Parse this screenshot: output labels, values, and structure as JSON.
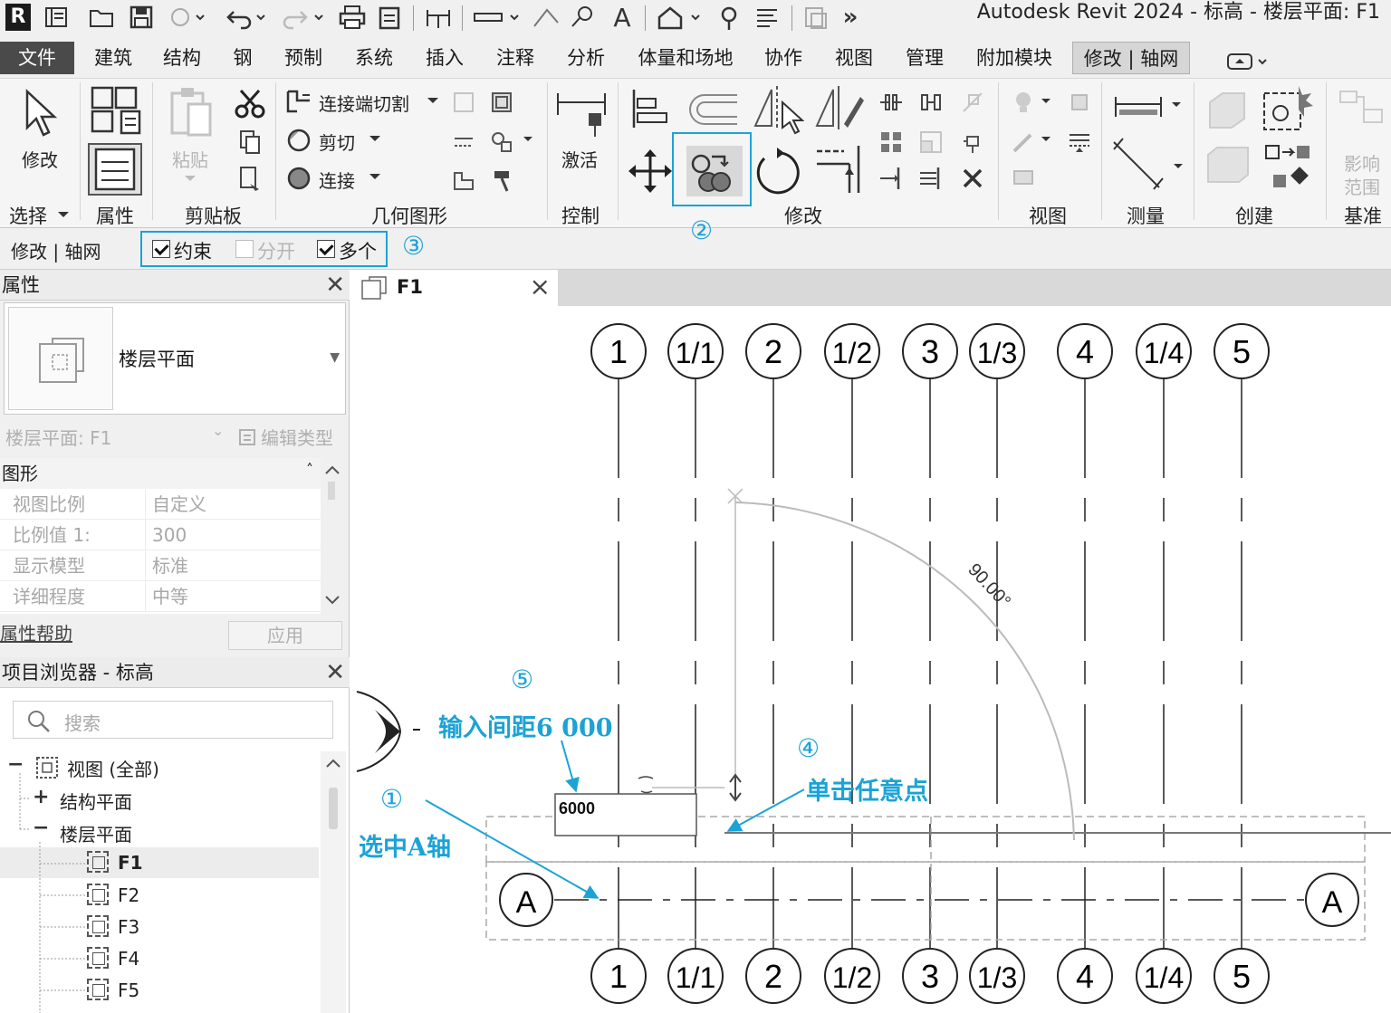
{
  "titlebar": {
    "app_logo": "R",
    "window_title": "Autodesk Revit 2024 - 标高 - 楼层平面: F1",
    "text_tool_glyph": "A",
    "overflow_glyph": "»"
  },
  "menu_tabs": [
    {
      "label": "文件"
    },
    {
      "label": "建筑"
    },
    {
      "label": "结构"
    },
    {
      "label": "钢"
    },
    {
      "label": "预制"
    },
    {
      "label": "系统"
    },
    {
      "label": "插入"
    },
    {
      "label": "注释"
    },
    {
      "label": "分析"
    },
    {
      "label": "体量和场地"
    },
    {
      "label": "协作"
    },
    {
      "label": "视图"
    },
    {
      "label": "管理"
    },
    {
      "label": "附加模块"
    },
    {
      "label": "修改 | 轴网"
    }
  ],
  "ribbon": {
    "select": {
      "modify_label": "修改",
      "panel": "选择"
    },
    "properties": {
      "panel": "属性"
    },
    "clipboard": {
      "paste_label": "粘贴",
      "panel": "剪贴板"
    },
    "geometry": {
      "cope_label": "连接端切割",
      "cut_label": "剪切",
      "join_label": "连接",
      "panel": "几何图形"
    },
    "control": {
      "activate_label": "激活",
      "panel": "控制"
    },
    "modify": {
      "panel": "修改"
    },
    "view": {
      "panel": "视图"
    },
    "measure": {
      "panel": "测量"
    },
    "create": {
      "panel": "创建"
    },
    "datum": {
      "scope_label_1": "影响",
      "scope_label_2": "范围",
      "panel": "基准"
    }
  },
  "options_bar": {
    "context": "修改 | 轴网",
    "constrain": {
      "label": "约束",
      "checked": true
    },
    "disjoin": {
      "label": "分开",
      "checked": false
    },
    "multiple": {
      "label": "多个",
      "checked": true
    }
  },
  "properties": {
    "title": "属性",
    "type_name": "楼层平面",
    "instance_label": "楼层平面: F1",
    "edit_type": "编辑类型",
    "group": "图形",
    "rows": [
      {
        "name": "视图比例",
        "value": "自定义"
      },
      {
        "name": "比例值 1:",
        "value": "300"
      },
      {
        "name": "显示模型",
        "value": "标准"
      },
      {
        "name": "详细程度",
        "value": "中等"
      }
    ],
    "help": "属性帮助",
    "apply": "应用"
  },
  "browser": {
    "title": "项目浏览器 - 标高",
    "search_placeholder": "搜索",
    "views_all": "视图 (全部)",
    "structural_plans": "结构平面",
    "floor_plans": "楼层平面",
    "levels": [
      "F1",
      "F2",
      "F3",
      "F4",
      "F5"
    ]
  },
  "view_tab": {
    "label": "F1"
  },
  "drawing": {
    "grid_labels": [
      "1",
      "1/1",
      "2",
      "1/2",
      "3",
      "1/3",
      "4",
      "1/4",
      "5"
    ],
    "row_grid_label": "A",
    "angle_label": "90.00°",
    "spacing_input": "6000"
  },
  "callouts": {
    "step1_num": "①",
    "step1_text": "选中A轴",
    "step2_num": "②",
    "step3_num": "③",
    "step4_num": "④",
    "step4_text": "单击任意点",
    "step5_num": "⑤",
    "step5_text": "输入间距6 000"
  },
  "colors": {
    "callout": "#1ba3d6",
    "file_tab": "#4a4a4a"
  }
}
